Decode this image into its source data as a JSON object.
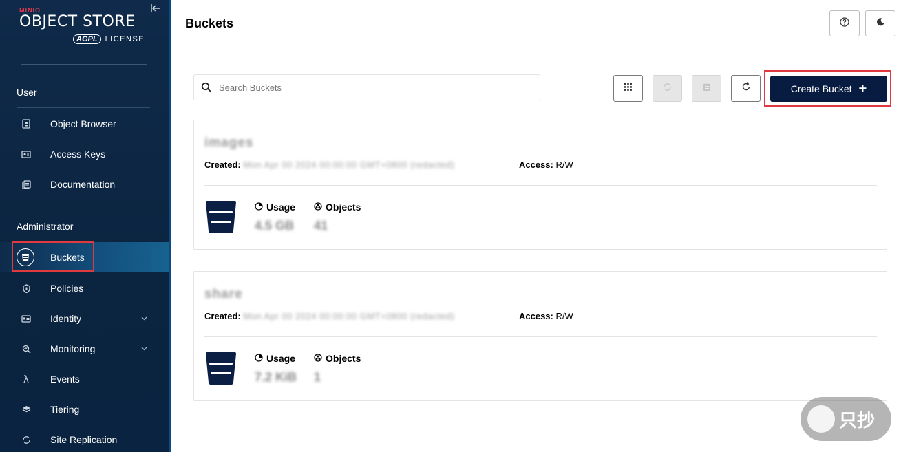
{
  "logo": {
    "brand": "MINIO",
    "title": "OBJECT STORE",
    "license_badge": "AGPL",
    "license": "LICENSE"
  },
  "sidebar": {
    "user_section": "User",
    "user_items": [
      {
        "label": "Object Browser",
        "icon": "object-browser-icon"
      },
      {
        "label": "Access Keys",
        "icon": "access-keys-icon"
      },
      {
        "label": "Documentation",
        "icon": "documentation-icon"
      }
    ],
    "admin_section": "Administrator",
    "admin_items": [
      {
        "label": "Buckets",
        "icon": "bucket-icon",
        "active": true
      },
      {
        "label": "Policies",
        "icon": "shield-icon"
      },
      {
        "label": "Identity",
        "icon": "identity-icon",
        "expandable": true
      },
      {
        "label": "Monitoring",
        "icon": "monitoring-icon",
        "expandable": true
      },
      {
        "label": "Events",
        "icon": "lambda-icon"
      },
      {
        "label": "Tiering",
        "icon": "layers-icon"
      },
      {
        "label": "Site Replication",
        "icon": "replication-icon"
      }
    ]
  },
  "header": {
    "title": "Buckets"
  },
  "toolbar": {
    "search_placeholder": "Search Buckets",
    "create_label": "Create Bucket"
  },
  "buckets": [
    {
      "name": "images",
      "created_label": "Created:",
      "created_value": "Mon Apr 00 2024 00:00:00 GMT+0800 (redacted)",
      "access_label": "Access:",
      "access_value": "R/W",
      "usage_label": "Usage",
      "usage_value": "4.5 GB",
      "objects_label": "Objects",
      "objects_value": "41"
    },
    {
      "name": "share",
      "created_label": "Created:",
      "created_value": "Mon Apr 00 2024 00:00:00 GMT+0800 (redacted)",
      "access_label": "Access:",
      "access_value": "R/W",
      "usage_label": "Usage",
      "usage_value": "7.2 KiB",
      "objects_label": "Objects",
      "objects_value": "1"
    }
  ],
  "watermark": "只抄",
  "colors": {
    "sidebar_bg": "#0f2a4a",
    "primary_button": "#081c42",
    "highlight_box": "#e03a3e"
  }
}
